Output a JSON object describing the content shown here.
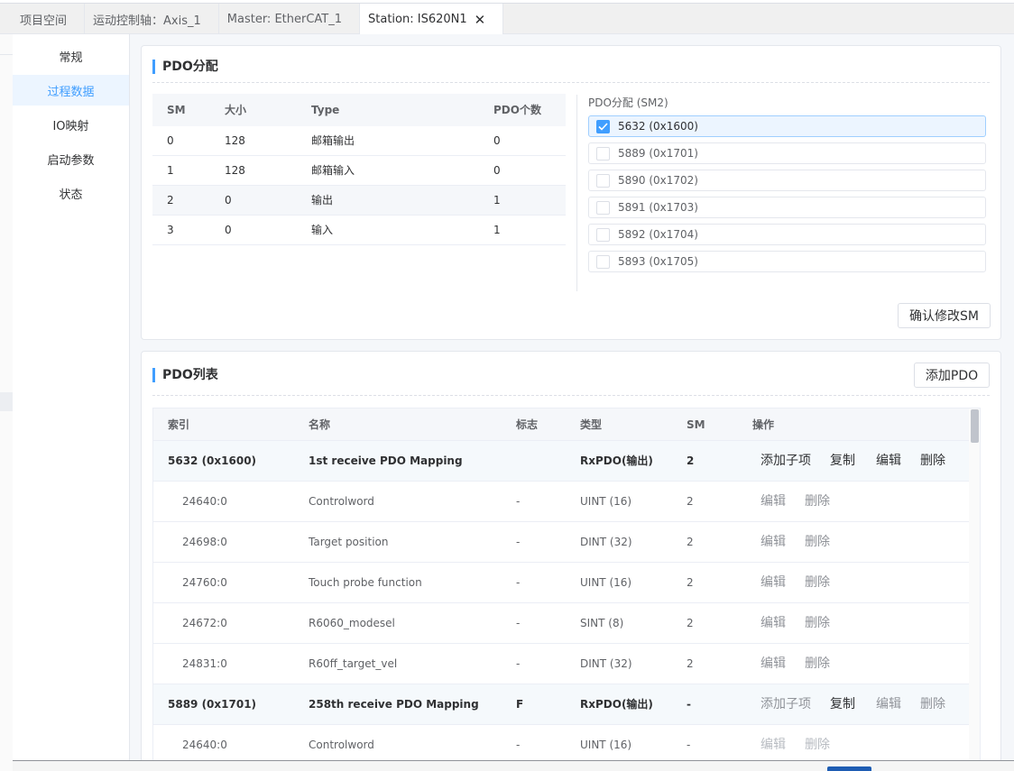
{
  "tabs": [
    {
      "label": "项目空间"
    },
    {
      "label": "运动控制轴：Axis_1"
    },
    {
      "label": "Master: EtherCAT_1"
    },
    {
      "label": "Station: IS620N1",
      "active": true
    }
  ],
  "sidenav": {
    "items": [
      {
        "label": "常规"
      },
      {
        "label": "过程数据",
        "active": true
      },
      {
        "label": "IO映射"
      },
      {
        "label": "启动参数"
      },
      {
        "label": "状态"
      }
    ]
  },
  "pdo_assign_card": {
    "title": "PDO分配",
    "sm_table": {
      "columns": [
        "SM",
        "大小",
        "Type",
        "PDO个数"
      ],
      "rows": [
        {
          "sm": "0",
          "size": "128",
          "type": "邮箱输出",
          "count": "0"
        },
        {
          "sm": "1",
          "size": "128",
          "type": "邮箱输入",
          "count": "0"
        },
        {
          "sm": "2",
          "size": "0",
          "type": "输出",
          "count": "1"
        },
        {
          "sm": "3",
          "size": "0",
          "type": "输入",
          "count": "1"
        }
      ]
    },
    "assign_label": "PDO分配 (SM2)",
    "assign_items": [
      {
        "label": "5632 (0x1600)",
        "checked": true
      },
      {
        "label": "5889 (0x1701)",
        "checked": false
      },
      {
        "label": "5890 (0x1702)",
        "checked": false
      },
      {
        "label": "5891 (0x1703)",
        "checked": false
      },
      {
        "label": "5892 (0x1704)",
        "checked": false
      },
      {
        "label": "5893 (0x1705)",
        "checked": false
      }
    ],
    "confirm_label": "确认修改SM"
  },
  "pdo_list_card": {
    "title": "PDO列表",
    "add_label": "添加PDO",
    "columns": [
      "索引",
      "名称",
      "标志",
      "类型",
      "SM",
      "操作"
    ],
    "actions": {
      "add_child": "添加子项",
      "copy": "复制",
      "edit": "编辑",
      "delete": "删除"
    },
    "rows": [
      {
        "index": "5632 (0x1600)",
        "name": "1st receive PDO Mapping",
        "flag": "",
        "type": "RxPDO(输出)",
        "sm": "2"
      },
      {
        "index": "24640:0",
        "name": "Controlword",
        "flag": "-",
        "type": "UINT (16)",
        "sm": "2"
      },
      {
        "index": "24698:0",
        "name": "Target position",
        "flag": "-",
        "type": "DINT (32)",
        "sm": "2"
      },
      {
        "index": "24760:0",
        "name": "Touch probe function",
        "flag": "-",
        "type": "UINT (16)",
        "sm": "2"
      },
      {
        "index": "24672:0",
        "name": "R6060_modesel",
        "flag": "-",
        "type": "SINT (8)",
        "sm": "2"
      },
      {
        "index": "24831:0",
        "name": "R60ff_target_vel",
        "flag": "-",
        "type": "DINT (32)",
        "sm": "2"
      },
      {
        "index": "5889 (0x1701)",
        "name": "258th receive PDO Mapping",
        "flag": "F",
        "type": "RxPDO(输出)",
        "sm": "-"
      },
      {
        "index": "24640:0",
        "name": "Controlword",
        "flag": "-",
        "type": "UINT (16)",
        "sm": "-"
      }
    ]
  },
  "colors": {
    "accent": "#409eff",
    "selected_bg": "#ecf5ff"
  }
}
